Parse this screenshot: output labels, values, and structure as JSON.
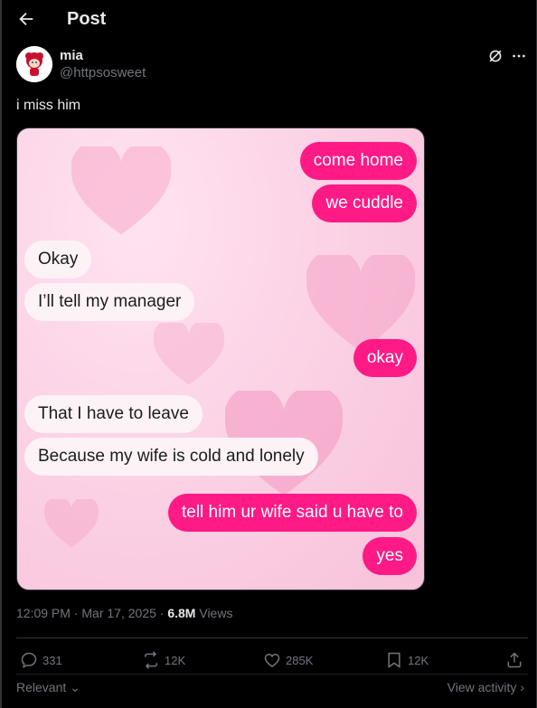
{
  "header": {
    "title": "Post",
    "back_icon": "arrow-left-icon"
  },
  "author": {
    "name": "mia",
    "handle": "@httpsosweet"
  },
  "post": {
    "text": "i miss him"
  },
  "chat": {
    "messages": [
      {
        "side": "sent",
        "text": "come home"
      },
      {
        "side": "sent",
        "text": "we cuddle"
      },
      {
        "side": "received",
        "text": "Okay"
      },
      {
        "side": "received",
        "text": "I’ll tell my manager"
      },
      {
        "side": "sent",
        "text": "okay"
      },
      {
        "side": "received",
        "text": "That I have to leave"
      },
      {
        "side": "received",
        "text": "Because my wife is cold and lonely"
      },
      {
        "side": "sent",
        "text": "tell him ur wife said u have to"
      },
      {
        "side": "sent",
        "text": "yes"
      }
    ],
    "colors": {
      "sent": "#ff1a85",
      "received": "#fdf3f7",
      "background": "#fcd3e6"
    }
  },
  "meta": {
    "time": "12:09 PM",
    "date": "Mar 17, 2025",
    "views_count": "6.8M",
    "views_label": "Views"
  },
  "actions": {
    "replies": "331",
    "reposts": "12K",
    "likes": "285K",
    "bookmarks": "12K"
  },
  "footer": {
    "sort_label": "Relevant",
    "activity_label": "View activity"
  }
}
